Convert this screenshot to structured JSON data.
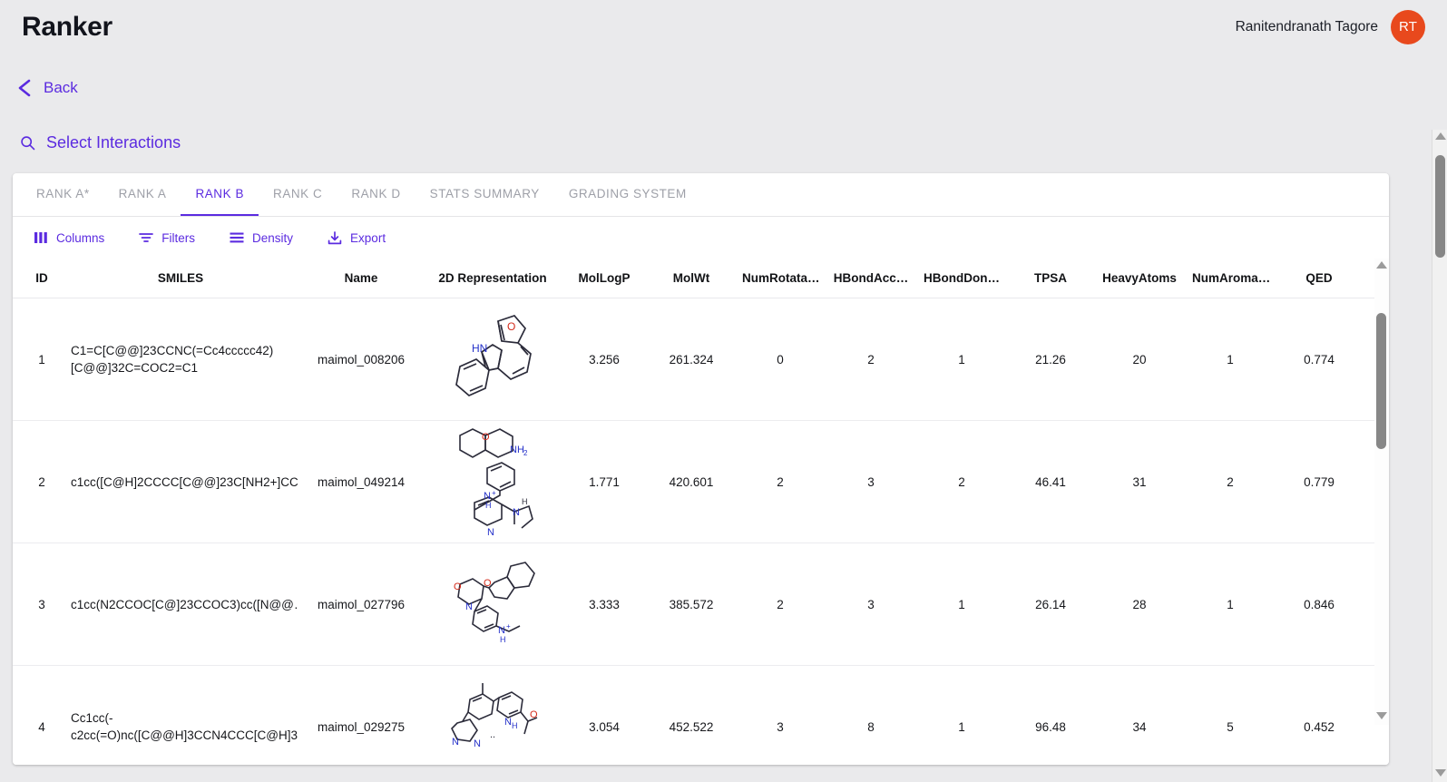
{
  "header": {
    "app_title": "Ranker",
    "user_name": "Ranitendranath Tagore",
    "avatar_initials": "RT"
  },
  "subheader": {
    "back_label": "Back",
    "back_icon": "chevron-left-icon",
    "select_interactions_label": "Select Interactions",
    "search_icon": "search-icon"
  },
  "tabs": [
    {
      "label": "RANK A*",
      "active": false
    },
    {
      "label": "RANK A",
      "active": false
    },
    {
      "label": "RANK B",
      "active": true
    },
    {
      "label": "RANK C",
      "active": false
    },
    {
      "label": "RANK D",
      "active": false
    },
    {
      "label": "STATS SUMMARY",
      "active": false
    },
    {
      "label": "GRADING SYSTEM",
      "active": false
    }
  ],
  "toolbar": [
    {
      "label": "Columns",
      "icon": "columns-icon"
    },
    {
      "label": "Filters",
      "icon": "filter-icon"
    },
    {
      "label": "Density",
      "icon": "density-icon"
    },
    {
      "label": "Export",
      "icon": "export-icon"
    }
  ],
  "table": {
    "columns": [
      "ID",
      "SMILES",
      "Name",
      "2D Representation",
      "MolLogP",
      "MolWt",
      "NumRotata…",
      "HBondAcc…",
      "HBondDon…",
      "TPSA",
      "HeavyAtoms",
      "NumAroma…",
      "QED"
    ],
    "rows": [
      {
        "id": "1",
        "smiles": "C1=C[C@@]23CCNC(=Cc4ccccc42)[C@@]32C=COC2=C1",
        "name": "maimol_008206",
        "mollogp": "3.256",
        "molwt": "261.324",
        "numrotatable": "0",
        "hbondacceptors": "2",
        "hbonddonors": "1",
        "tpsa": "21.26",
        "heavyatoms": "20",
        "numaromatic": "1",
        "qed": "0.774"
      },
      {
        "id": "2",
        "smiles": "c1cc([C@H]2CCCC[C@@]23C[NH2+]CC…",
        "name": "maimol_049214",
        "mollogp": "1.771",
        "molwt": "420.601",
        "numrotatable": "2",
        "hbondacceptors": "3",
        "hbonddonors": "2",
        "tpsa": "46.41",
        "heavyatoms": "31",
        "numaromatic": "2",
        "qed": "0.779"
      },
      {
        "id": "3",
        "smiles": "c1cc(N2CCOC[C@]23CCOC3)cc([N@@…",
        "name": "maimol_027796",
        "mollogp": "3.333",
        "molwt": "385.572",
        "numrotatable": "2",
        "hbondacceptors": "3",
        "hbonddonors": "1",
        "tpsa": "26.14",
        "heavyatoms": "28",
        "numaromatic": "1",
        "qed": "0.846"
      },
      {
        "id": "4",
        "smiles": "Cc1cc(-c2cc(=O)nc([C@@H]3CCN4CCC[C@H]3…",
        "name": "maimol_029275",
        "mollogp": "3.054",
        "molwt": "452.522",
        "numrotatable": "3",
        "hbondacceptors": "8",
        "hbonddonors": "1",
        "tpsa": "96.48",
        "heavyatoms": "34",
        "numaromatic": "5",
        "qed": "0.452"
      }
    ]
  },
  "colors": {
    "accent": "#5b2be0",
    "avatar": "#e8491d",
    "page_bg": "#eaeaec",
    "text": "#16171b",
    "muted": "#9ea0a8"
  }
}
